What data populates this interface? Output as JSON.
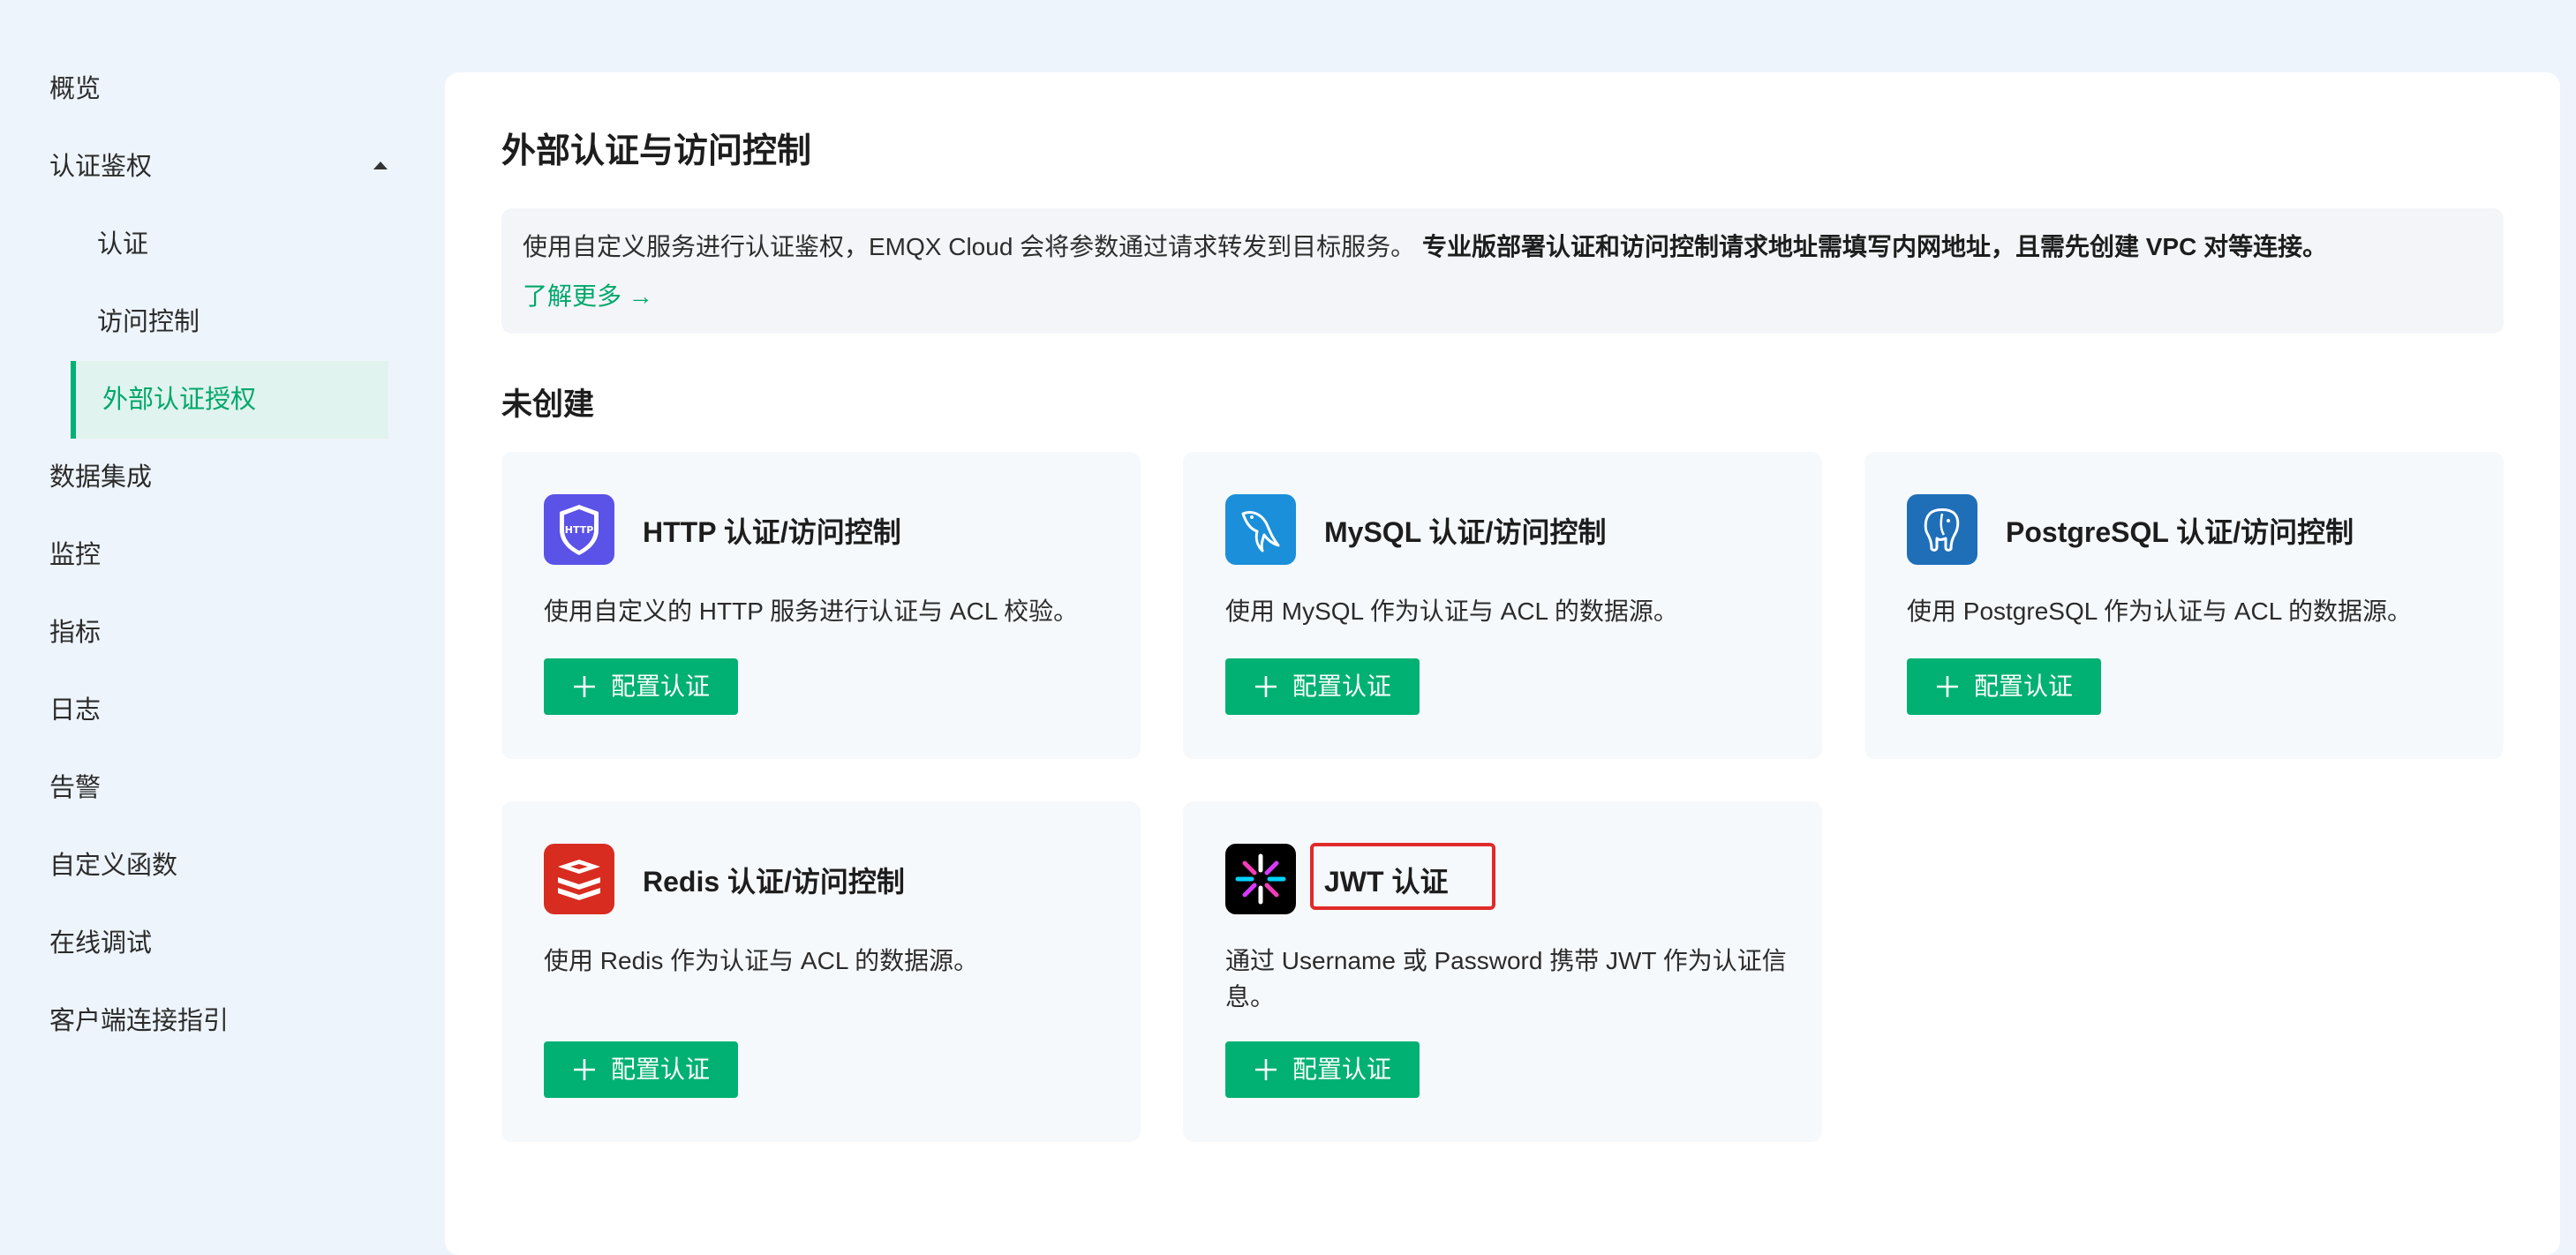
{
  "sidebar": {
    "items": [
      {
        "label": "概览"
      },
      {
        "label": "认证鉴权"
      },
      {
        "label": "认证"
      },
      {
        "label": "访问控制"
      },
      {
        "label": "外部认证授权"
      },
      {
        "label": "数据集成"
      },
      {
        "label": "监控"
      },
      {
        "label": "指标"
      },
      {
        "label": "日志"
      },
      {
        "label": "告警"
      },
      {
        "label": "自定义函数"
      },
      {
        "label": "在线调试"
      },
      {
        "label": "客户端连接指引"
      }
    ]
  },
  "main": {
    "title": "外部认证与访问控制",
    "info": {
      "text": "使用自定义服务进行认证鉴权，EMQX Cloud 会将参数通过请求转发到目标服务。",
      "bold_text": "专业版部署认证和访问控制请求地址需填写内网地址，且需先创建 VPC 对等连接。",
      "link": "了解更多 →"
    },
    "section_title": "未创建",
    "button_label": "配置认证",
    "cards": [
      {
        "title": "HTTP 认证/访问控制",
        "desc": "使用自定义的 HTTP 服务进行认证与 ACL 校验。",
        "logo_text": "HTTP",
        "logo": "http-shield-icon",
        "color": "#5b52e8"
      },
      {
        "title": "MySQL 认证/访问控制",
        "desc": "使用 MySQL 作为认证与 ACL 的数据源。",
        "logo": "mysql-dolphin-icon",
        "color": "#1b8fd9"
      },
      {
        "title": "PostgreSQL 认证/访问控制",
        "desc": "使用 PostgreSQL 作为认证与 ACL 的数据源。",
        "logo": "postgresql-elephant-icon",
        "color": "#1f6fb8"
      },
      {
        "title": "Redis 认证/访问控制",
        "desc": "使用 Redis 作为认证与 ACL 的数据源。",
        "logo": "redis-stack-icon",
        "color": "#d82c20"
      },
      {
        "title": "JWT 认证",
        "desc": "通过 Username 或 Password 携带 JWT 作为认证信息。",
        "logo": "jwt-burst-icon",
        "color": "#000000"
      }
    ]
  },
  "colors": {
    "accent": "#00b173",
    "highlight": "#e02a2a",
    "background": "#eef4fb"
  }
}
